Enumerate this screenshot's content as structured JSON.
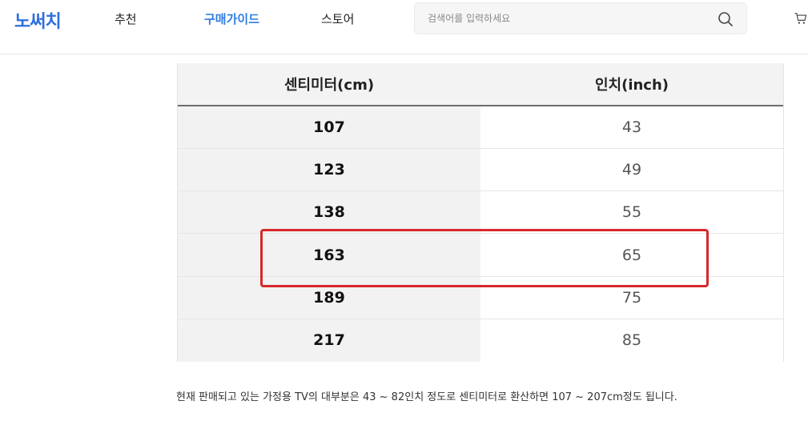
{
  "header": {
    "logo": "노써치",
    "nav": [
      {
        "label": "추천",
        "active": false
      },
      {
        "label": "구매가이드",
        "active": true
      },
      {
        "label": "스토어",
        "active": false
      }
    ],
    "search": {
      "placeholder": "검색어를 입력하세요",
      "value": ""
    }
  },
  "table": {
    "headers": [
      "센티미터(cm)",
      "인치(inch)"
    ],
    "rows": [
      {
        "cm": "107",
        "inch": "43"
      },
      {
        "cm": "123",
        "inch": "49"
      },
      {
        "cm": "138",
        "inch": "55"
      },
      {
        "cm": "163",
        "inch": "65"
      },
      {
        "cm": "189",
        "inch": "75"
      },
      {
        "cm": "217",
        "inch": "85"
      }
    ]
  },
  "footnote": "현재 판매되고 있는 가정용 TV의 대부분은 43 ~ 82인치 정도로 센티미터로 환산하면 107 ~ 207cm정도 됩니다.",
  "colors": {
    "accent": "#2f7de1",
    "highlight": "#d8282c"
  }
}
